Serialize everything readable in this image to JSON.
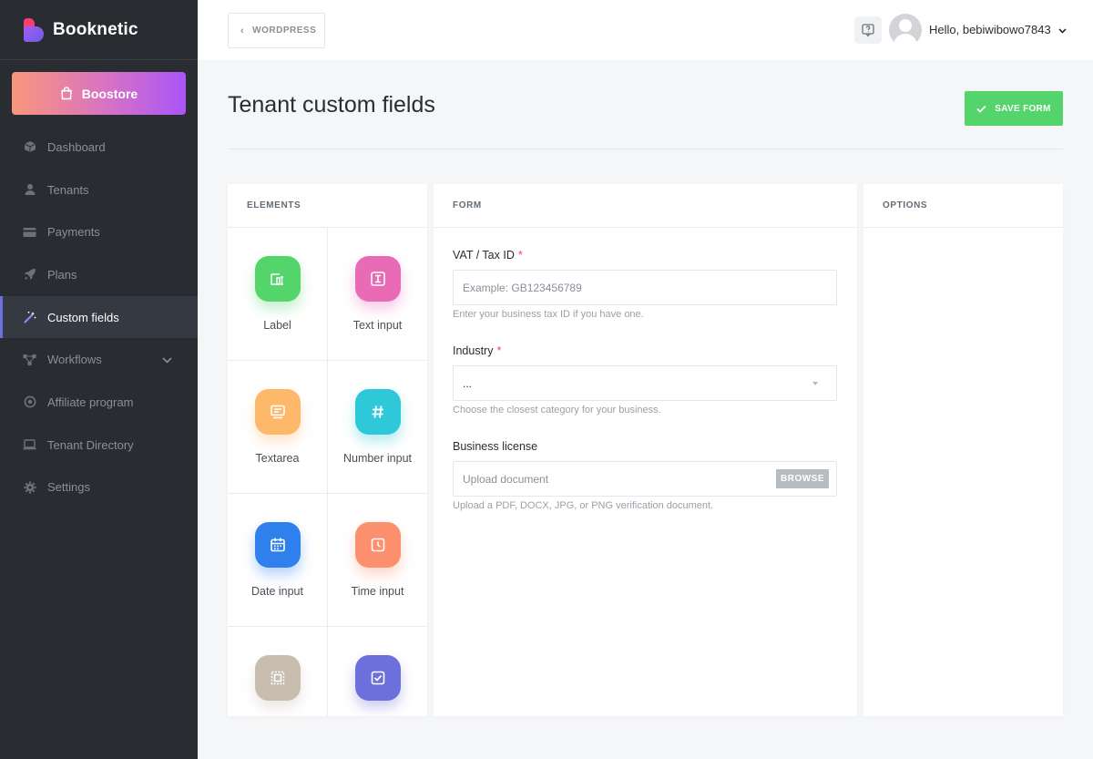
{
  "brand": {
    "name": "Booknetic"
  },
  "sidebar": {
    "boostore_label": "Boostore",
    "items": [
      {
        "label": "Dashboard",
        "icon": "cube-icon"
      },
      {
        "label": "Tenants",
        "icon": "user-icon"
      },
      {
        "label": "Payments",
        "icon": "credit-card-icon"
      },
      {
        "label": "Plans",
        "icon": "rocket-icon"
      },
      {
        "label": "Custom fields",
        "icon": "magic-wand-icon",
        "active": true
      },
      {
        "label": "Workflows",
        "icon": "workflow-icon",
        "has_submenu": true
      },
      {
        "label": "Affiliate program",
        "icon": "target-icon"
      },
      {
        "label": "Tenant Directory",
        "icon": "laptop-icon"
      },
      {
        "label": "Settings",
        "icon": "gear-icon"
      }
    ]
  },
  "topbar": {
    "back_label": "WORDPRESS",
    "greeting": "Hello, bebiwibowo7843"
  },
  "page": {
    "title": "Tenant custom fields",
    "save_label": "SAVE FORM"
  },
  "panels": {
    "elements_title": "ELEMENTS",
    "form_title": "FORM",
    "options_title": "OPTIONS"
  },
  "elements": [
    {
      "label": "Label",
      "icon": "label-icon",
      "color": "#53d56c"
    },
    {
      "label": "Text input",
      "icon": "text-input-icon",
      "color": "#e96bb6"
    },
    {
      "label": "Textarea",
      "icon": "textarea-icon",
      "color": "#fdb86a"
    },
    {
      "label": "Number input",
      "icon": "hash-icon",
      "color": "#2ec8d8"
    },
    {
      "label": "Date input",
      "icon": "calendar-icon",
      "color": "#2f80ed"
    },
    {
      "label": "Time input",
      "icon": "clock-icon",
      "color": "#fb8f6e"
    },
    {
      "label": "",
      "icon": "select-icon",
      "color": "#c8bdae"
    },
    {
      "label": "",
      "icon": "checkbox-icon",
      "color": "#6c70dc"
    }
  ],
  "form": {
    "vat": {
      "label": "VAT / Tax ID",
      "required_mark": "*",
      "placeholder": "Example: GB123456789",
      "help": "Enter your business tax ID if you have one."
    },
    "industry": {
      "label": "Industry",
      "required_mark": "*",
      "value": "...",
      "help": "Choose the closest category for your business."
    },
    "license": {
      "label": "Business license",
      "placeholder": "Upload document",
      "browse_label": "BROWSE",
      "help": "Upload a PDF, DOCX, JPG, or PNG verification document."
    }
  }
}
